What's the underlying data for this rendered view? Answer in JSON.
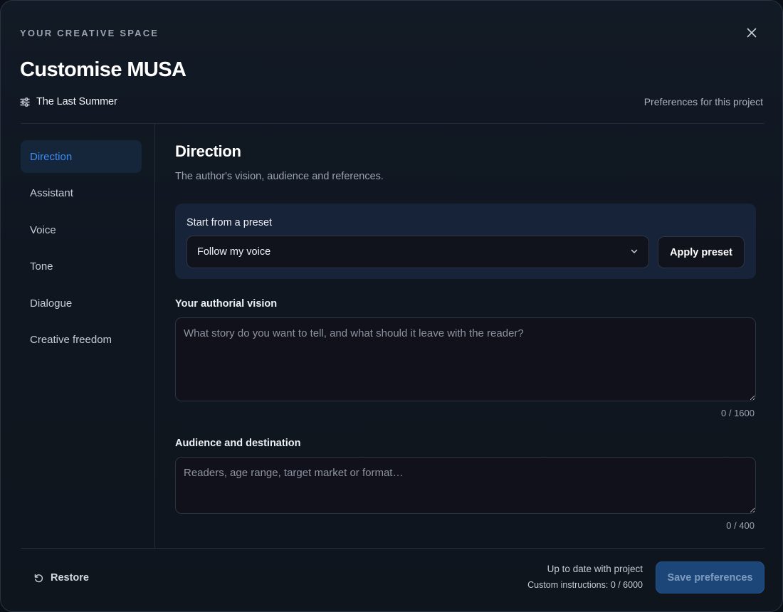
{
  "header": {
    "eyebrow": "YOUR CREATIVE SPACE",
    "title": "Customise MUSA",
    "project_name": "The Last Summer",
    "scope_note": "Preferences for this project",
    "close_icon": "close-icon",
    "project_icon": "sliders-icon"
  },
  "sidebar": {
    "items": [
      {
        "label": "Direction",
        "active": true
      },
      {
        "label": "Assistant"
      },
      {
        "label": "Voice"
      },
      {
        "label": "Tone"
      },
      {
        "label": "Dialogue"
      },
      {
        "label": "Creative freedom"
      }
    ]
  },
  "section": {
    "title": "Direction",
    "description": "The author's vision, audience and references."
  },
  "preset": {
    "label": "Start from a preset",
    "selected": "Follow my voice",
    "apply_label": "Apply preset"
  },
  "vision": {
    "label": "Your authorial vision",
    "placeholder": "What story do you want to tell, and what should it leave with the reader?",
    "value": "",
    "counter": "0 / 1600"
  },
  "audience": {
    "label": "Audience and destination",
    "placeholder": "Readers, age range, target market or format…",
    "value": "",
    "counter": "0 / 400"
  },
  "footer": {
    "restore_label": "Restore",
    "status_line": "Up to date with project",
    "instructions_count": "Custom instructions: 0 / 6000",
    "save_label": "Save preferences"
  },
  "colors": {
    "accent": "#3d8bf2",
    "nav_active_bg": "#15253a",
    "save_button_bg": "#1c4677"
  }
}
